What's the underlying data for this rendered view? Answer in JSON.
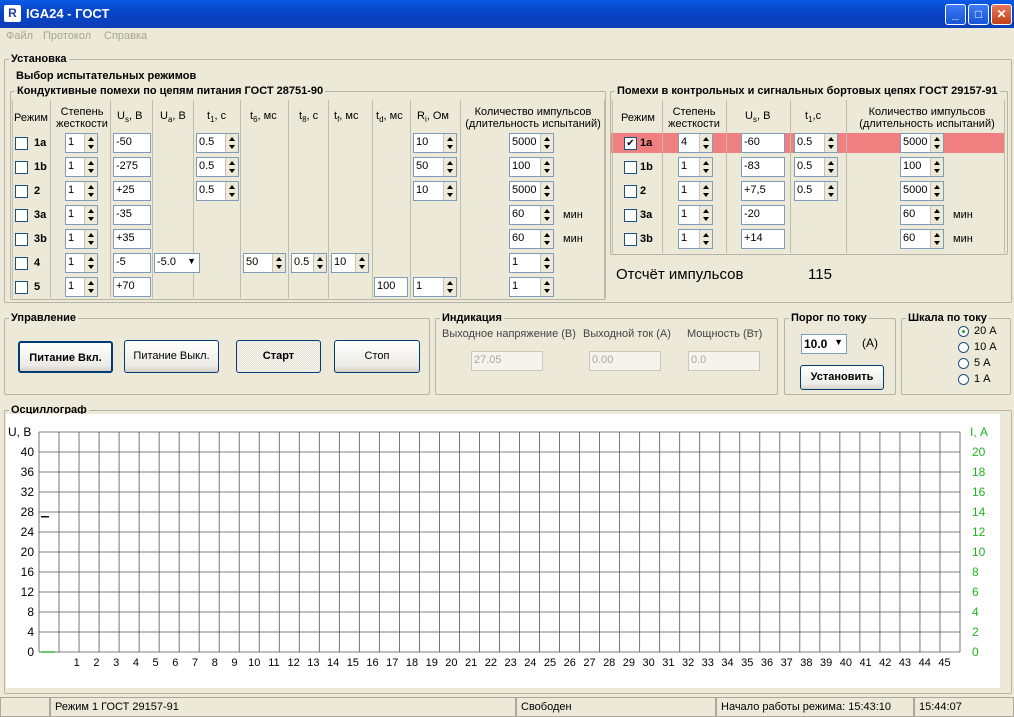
{
  "window": {
    "title": "IGA24 - ГОСТ",
    "icon": "app-icon"
  },
  "menu": [
    "Файл",
    "Протокол",
    "Справка"
  ],
  "setup": {
    "title": "Установка",
    "test_modes_title": "Выбор испытательных режимов"
  },
  "left_table": {
    "title": "Кондуктивные помехи по цепям питания ГОСТ 28751-90",
    "headers": {
      "mode": "Режим",
      "severity": "Степень жесткости",
      "us": "U",
      "us_sub": "s",
      "us_unit": ", В",
      "ua": "U",
      "ua_sub": "a",
      "ua_unit": ", В",
      "t1": "t",
      "t1_sub": "1",
      "t1_unit": ", с",
      "t6": "t",
      "t6_sub": "6",
      "t6_unit": ", мс",
      "t8": "t",
      "t8_sub": "8",
      "t8_unit": ", с",
      "tf": "t",
      "tf_sub": "f",
      "tf_unit": ", мс",
      "td": "t",
      "td_sub": "d",
      "td_unit": ", мс",
      "ri": "R",
      "ri_sub": "i",
      "ri_unit": ", Ом",
      "count": "Количество импульсов (длительность испытаний)"
    },
    "rows": [
      {
        "mode": "1a",
        "sev": "1",
        "us": "-50",
        "t1": "0.5",
        "ri": "10",
        "count": "5000",
        "unit": ""
      },
      {
        "mode": "1b",
        "sev": "1",
        "us": "-275",
        "t1": "0.5",
        "ri": "50",
        "count": "100",
        "unit": ""
      },
      {
        "mode": "2",
        "sev": "1",
        "us": "+25",
        "t1": "0.5",
        "ri": "10",
        "count": "5000",
        "unit": ""
      },
      {
        "mode": "3a",
        "sev": "1",
        "us": "-35",
        "count": "60",
        "unit": "мин"
      },
      {
        "mode": "3b",
        "sev": "1",
        "us": "+35",
        "count": "60",
        "unit": "мин"
      },
      {
        "mode": "4",
        "sev": "1",
        "us": "-5",
        "ua": "-5.0",
        "t6": "50",
        "t8": "0.5",
        "tf": "10",
        "count": "1",
        "unit": ""
      },
      {
        "mode": "5",
        "sev": "1",
        "us": "+70",
        "td": "100",
        "ri": "1",
        "count": "1",
        "unit": ""
      }
    ]
  },
  "right_table": {
    "title": "Помехи в контрольных и сигнальных бортовых цепях ГОСТ 29157-91",
    "headers": {
      "mode": "Режим",
      "severity": "Степень жесткости",
      "us": "U",
      "us_sub": "s",
      "us_unit": ", В",
      "t1": "t",
      "t1_sub": "1",
      "t1_unit": ",с",
      "count": "Количество импульсов (длительность испытаний)"
    },
    "rows": [
      {
        "mode": "1a",
        "sev": "4",
        "us": "-60",
        "t1": "0.5",
        "count": "5000",
        "unit": "",
        "checked": true
      },
      {
        "mode": "1b",
        "sev": "1",
        "us": "-83",
        "t1": "0.5",
        "count": "100",
        "unit": ""
      },
      {
        "mode": "2",
        "sev": "1",
        "us": "+7,5",
        "t1": "0.5",
        "count": "5000",
        "unit": ""
      },
      {
        "mode": "3a",
        "sev": "1",
        "us": "-20",
        "count": "60",
        "unit": "мин"
      },
      {
        "mode": "3b",
        "sev": "1",
        "us": "+14",
        "count": "60",
        "unit": "мин"
      }
    ],
    "pulse_count_label": "Отсчёт импульсов",
    "pulse_count_value": "115",
    "highlight_color": "#f08080"
  },
  "control": {
    "title": "Управление",
    "power_on": "Питание Вкл.",
    "power_off": "Питание Выкл.",
    "start": "Старт",
    "stop": "Стоп"
  },
  "indication": {
    "title": "Индикация",
    "voltage_label": "Выходное напряжение (В)",
    "current_label": "Выходной ток (А)",
    "power_label": "Мощность (Вт)",
    "voltage": "27.05",
    "current": "0.00",
    "power": "0.0"
  },
  "threshold": {
    "title": "Порог по току",
    "value": "10.0",
    "unit": "(А)",
    "set_label": "Установить"
  },
  "scale": {
    "title": "Шкала по току",
    "options": [
      "20 А",
      "10 А",
      "5 А",
      "1 А"
    ],
    "selected": 0
  },
  "osc": {
    "title": "Осциллограф",
    "ylabel_left": "U, В",
    "ylabel_right": "I, А",
    "y_left": [
      "40",
      "36",
      "32",
      "28",
      "24",
      "20",
      "16",
      "12",
      "8",
      "4",
      "0"
    ],
    "y_right": [
      "20",
      "18",
      "16",
      "14",
      "12",
      "10",
      "8",
      "6",
      "4",
      "2",
      "0"
    ],
    "x_ticks": [
      "1",
      "2",
      "3",
      "4",
      "5",
      "6",
      "7",
      "8",
      "9",
      "10",
      "11",
      "12",
      "13",
      "14",
      "15",
      "16",
      "17",
      "18",
      "19",
      "20",
      "21",
      "22",
      "23",
      "24",
      "25",
      "26",
      "27",
      "28",
      "29",
      "30",
      "31",
      "32",
      "33",
      "34",
      "35",
      "36",
      "37",
      "38",
      "39",
      "40",
      "41",
      "42",
      "43",
      "44",
      "45"
    ],
    "right_color": "#22b422",
    "voltage_trace": [
      [
        0,
        27.05
      ],
      [
        1,
        27.05
      ]
    ]
  },
  "status": {
    "mode": "Режим 1 ГОСТ 29157-91",
    "state": "Свободен",
    "start_time": "Начало работы режима: 15:43:10",
    "clock": "15:44:07"
  }
}
